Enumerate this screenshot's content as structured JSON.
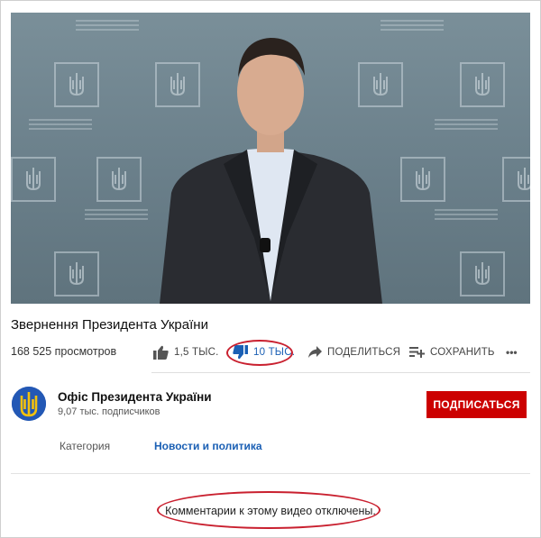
{
  "video": {
    "title": "Звернення Президента України",
    "views": "168 525 просмотров"
  },
  "actions": {
    "like_count": "1,5 ТЫС.",
    "dislike_count": "10 ТЫС.",
    "share_label": "ПОДЕЛИТЬСЯ",
    "save_label": "СОХРАНИТЬ",
    "more_label": "•••"
  },
  "channel": {
    "name": "Офіс Президента України",
    "subscribers": "9,07 тыс. подписчиков",
    "subscribe_label": "ПОДПИСАТЬСЯ"
  },
  "metadata": {
    "category_label": "Категория",
    "category_value": "Новости и политика"
  },
  "comments_notice": "Комментарии к этому видео отключены.",
  "colors": {
    "subscribe_bg": "#cc0000",
    "link": "#1a5fb4",
    "active_dislike": "#1a5fb4",
    "highlight_oval": "#c9202f"
  },
  "icons": [
    "thumbs-up-icon",
    "thumbs-down-icon",
    "share-arrow-icon",
    "add-to-playlist-icon",
    "more-icon",
    "trident-emblem-icon"
  ]
}
